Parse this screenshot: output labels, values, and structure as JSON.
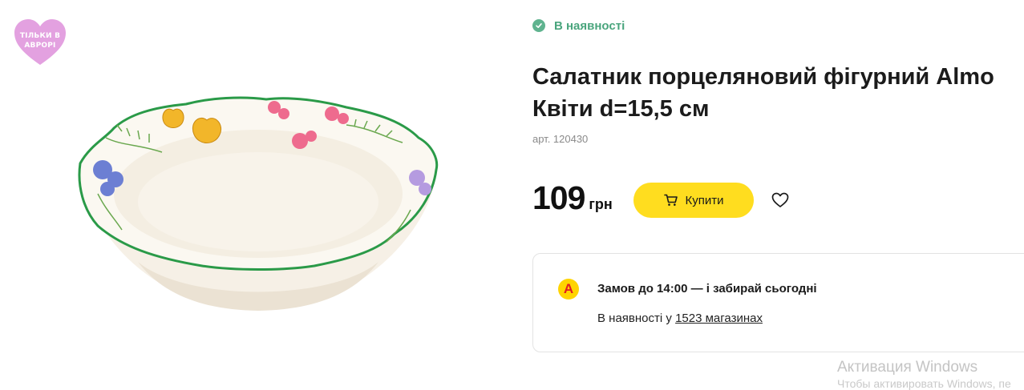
{
  "badge": {
    "line1": "ТІЛЬКИ В",
    "line2": "АВРОРІ",
    "color": "#e3a1e0"
  },
  "product": {
    "image_icon": "salad-bowl-image",
    "stock_status": "В наявності",
    "title_line1": "Салатник порцеляновий фігурний Almo",
    "title_line2": "Квіти d=15,5 см",
    "sku": "арт. 120430",
    "price": "109",
    "currency": "грн",
    "buy_label": "Купити",
    "favorite_icon": "heart-outline-icon"
  },
  "pickup": {
    "logo_letter": "А",
    "title": "Замов до 14:00 — і забирай сьогодні",
    "stock_prefix": "В наявності у",
    "stock_link": "1523 магазинах"
  },
  "os_overlay": {
    "title": "Активация Windows",
    "subtitle": "Чтобы активировать Windows, пе"
  },
  "colors": {
    "accent_yellow": "#ffdd1f",
    "in_stock_green": "#4aa57d",
    "brand_red": "#e21b22"
  }
}
